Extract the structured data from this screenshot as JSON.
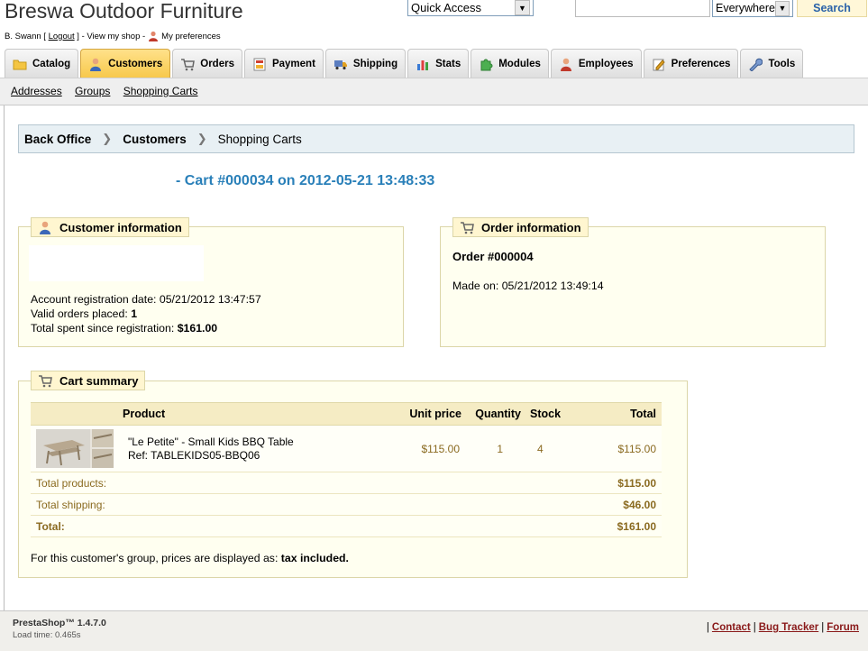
{
  "header": {
    "shop_title": "Breswa Outdoor Furniture",
    "user_name": "B. Swann",
    "logout_label": "Logout",
    "view_shop_label": "View my shop",
    "preferences_label": "My preferences",
    "quick_access_value": "Quick Access",
    "search_value": "",
    "scope_value": "Everywhere",
    "search_button": "Search"
  },
  "tabs": [
    {
      "label": "Catalog",
      "icon": "folder-icon",
      "active": false
    },
    {
      "label": "Customers",
      "icon": "customer-icon",
      "active": true
    },
    {
      "label": "Orders",
      "icon": "cart-icon",
      "active": false
    },
    {
      "label": "Payment",
      "icon": "payment-icon",
      "active": false
    },
    {
      "label": "Shipping",
      "icon": "truck-icon",
      "active": false
    },
    {
      "label": "Stats",
      "icon": "chart-icon",
      "active": false
    },
    {
      "label": "Modules",
      "icon": "puzzle-icon",
      "active": false
    },
    {
      "label": "Employees",
      "icon": "employee-icon",
      "active": false
    },
    {
      "label": "Preferences",
      "icon": "preferences-icon",
      "active": false
    },
    {
      "label": "Tools",
      "icon": "wrench-icon",
      "active": false
    }
  ],
  "subnav": [
    "Addresses",
    "Groups",
    "Shopping Carts"
  ],
  "breadcrumb": [
    "Back Office",
    "Customers",
    "Shopping Carts"
  ],
  "cart_title": "- Cart #000034 on 2012-05-21 13:48:33",
  "customer_info": {
    "legend": "Customer information",
    "registration_label": "Account registration date:",
    "registration_value": "05/21/2012 13:47:57",
    "orders_label": "Valid orders placed:",
    "orders_value": "1",
    "spent_label": "Total spent since registration:",
    "spent_value": "$161.00"
  },
  "order_info": {
    "legend": "Order information",
    "order_number": "Order #000004",
    "made_on_label": "Made on:",
    "made_on_value": "05/21/2012 13:49:14"
  },
  "cart_summary": {
    "legend": "Cart summary",
    "columns": [
      "Product",
      "Unit price",
      "Quantity",
      "Stock",
      "Total"
    ],
    "item": {
      "name": "\"Le Petite\" - Small Kids BBQ Table",
      "ref": "Ref: TABLEKIDS05-BBQ06",
      "unit_price": "$115.00",
      "quantity": "1",
      "stock": "4",
      "total": "$115.00"
    },
    "totals": [
      {
        "label": "Total products:",
        "value": "$115.00"
      },
      {
        "label": "Total shipping:",
        "value": "$46.00"
      },
      {
        "label": "Total:",
        "value": "$161.00"
      }
    ],
    "tax_prefix": "For this customer's group, prices are displayed as:",
    "tax_value": "tax included."
  },
  "footer": {
    "version": "PrestaShop™ 1.4.7.0",
    "load_time": "Load time: 0.465s",
    "links": [
      "Contact",
      "Bug Tracker",
      "Forum"
    ]
  }
}
